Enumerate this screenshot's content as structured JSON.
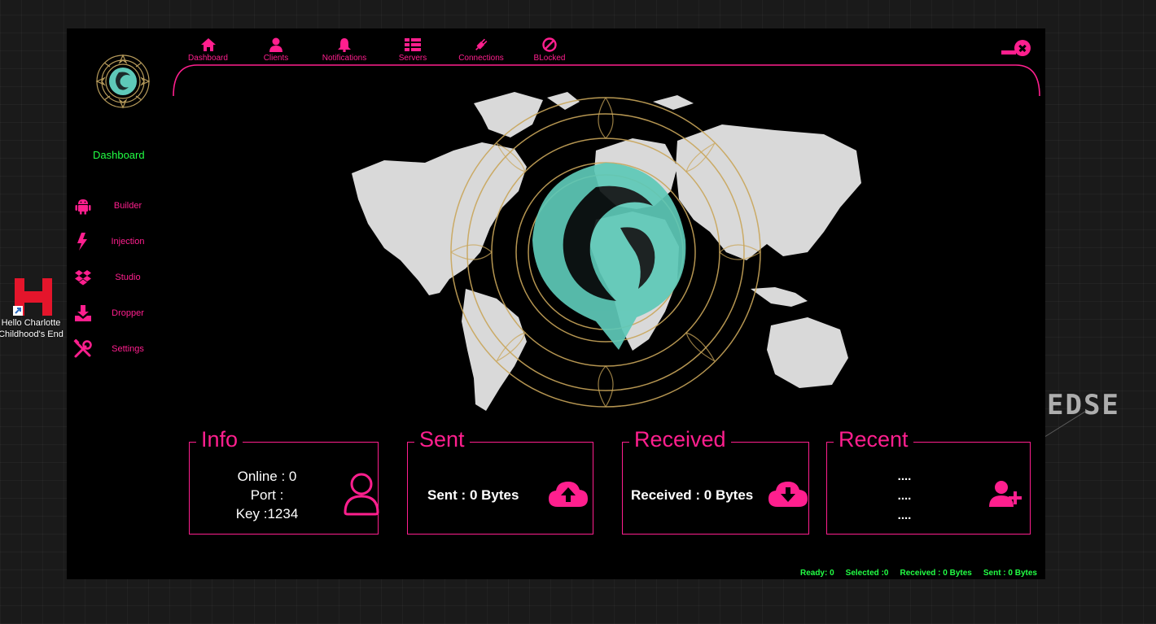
{
  "colors": {
    "accent": "#ff1f8e",
    "status": "#22ff44",
    "background": "#000000"
  },
  "desktop": {
    "shortcut": {
      "label_line1": "Hello Charlotte",
      "label_line2": "Childhood's End"
    },
    "background_text": "EDSE"
  },
  "topnav": [
    {
      "label": "Dashboard",
      "icon": "home-icon"
    },
    {
      "label": "Clients",
      "icon": "user-icon"
    },
    {
      "label": "Notifications",
      "icon": "bell-icon"
    },
    {
      "label": "Servers",
      "icon": "list-icon"
    },
    {
      "label": "Connections",
      "icon": "plug-icon"
    },
    {
      "label": "BLocked",
      "icon": "ban-icon"
    }
  ],
  "sidebar": {
    "title": "Dashboard",
    "items": [
      {
        "label": "Builder",
        "icon": "android-icon"
      },
      {
        "label": "Injection",
        "icon": "bolt-icon"
      },
      {
        "label": "Studio",
        "icon": "dropbox-icon"
      },
      {
        "label": "Dropper",
        "icon": "download-icon"
      },
      {
        "label": "Settings",
        "icon": "tools-icon"
      }
    ]
  },
  "panels": {
    "info": {
      "title": "Info",
      "online": "Online : 0",
      "port": "Port :",
      "key": "Key :1234",
      "icon": "user-outline-icon"
    },
    "sent": {
      "title": "Sent",
      "text": "Sent : 0 Bytes",
      "icon": "cloud-upload-icon"
    },
    "received": {
      "title": "Received",
      "text": "Received : 0 Bytes",
      "icon": "cloud-download-icon"
    },
    "recent": {
      "title": "Recent",
      "lines": [
        "....",
        "....",
        "...."
      ],
      "icon": "user-plus-icon"
    }
  },
  "statusbar": {
    "ready": "Ready: 0",
    "selected": "Selected :0",
    "received": "Received : 0 Bytes",
    "sent": "Sent : 0 Bytes"
  }
}
